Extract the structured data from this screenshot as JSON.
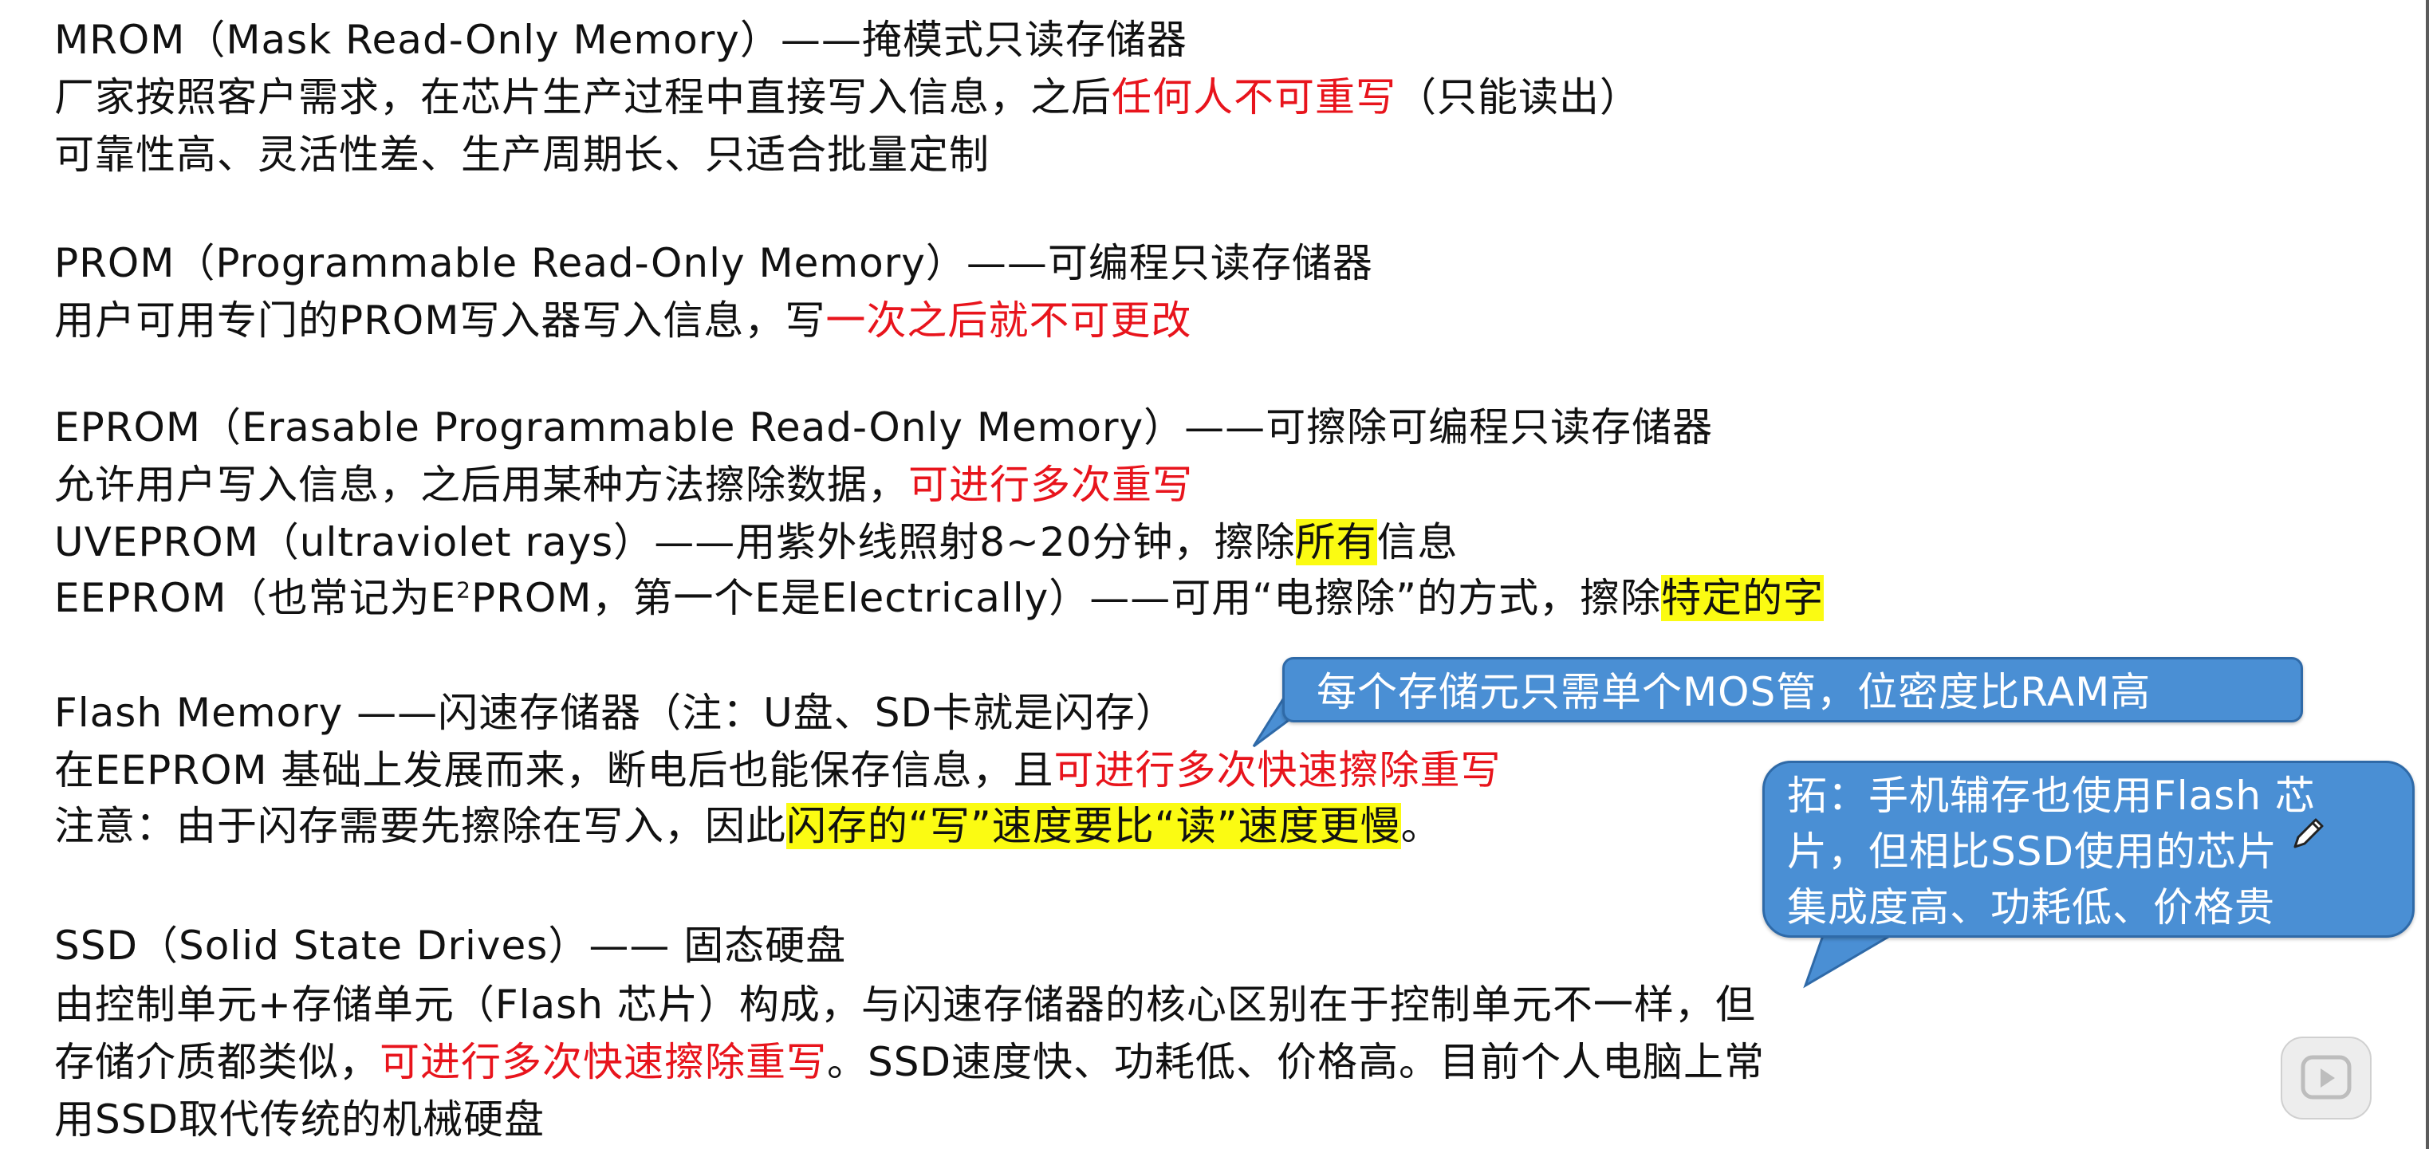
{
  "lines": {
    "l1": [
      "MROM（Mask Read-Only Memory）——掩模式只读存储器"
    ],
    "l2": [
      "厂家按照客户需求，在芯片生产过程中直接写入信息，之后",
      "任何人不可重写",
      "（只能读出）"
    ],
    "l3": [
      "可靠性高、灵活性差、生产周期长、只适合批量定制"
    ],
    "l4": [
      "PROM（Programmable Read-Only Memory）——可编程只读存储器"
    ],
    "l5": [
      "用户可用专门的PROM写入器写入信息，写",
      "一次之后就不可更改"
    ],
    "l6": [
      "EPROM（Erasable Programmable Read-Only Memory）——可擦除可编程只读存储器"
    ],
    "l7": [
      "允许用户写入信息，之后用某种方法擦除数据，",
      "可进行多次重写"
    ],
    "l8": [
      "UVEPROM（ultraviolet rays）——用紫外线照射8~20分钟，擦除",
      "所有",
      "信息"
    ],
    "l9": [
      "EEPROM（也常记为E",
      "2",
      "PROM，第一个E是Electrically）——可用“电擦除”的方式，擦除",
      "特定的字"
    ],
    "l10": [
      "Flash Memory ——闪速存储器（注：U盘、SD卡就是闪存）"
    ],
    "l11": [
      "在EEPROM 基础上发展而来，断电后也能保存信息，且",
      "可进行多次快速擦除重写"
    ],
    "l12": [
      "注意：由于闪存需要先擦除在写入，因此",
      "闪存的“写”速度要比“读”速度更慢",
      "。"
    ],
    "l13": [
      "SSD（Solid State Drives）—— 固态硬盘"
    ],
    "l14": [
      "由控制单元+存储单元（Flash 芯片）构成，与闪速存储器的核心区别在于控制单元不一样，但"
    ],
    "l15": [
      "存储介质都类似，",
      "可进行多次快速擦除重写",
      "。SSD速度快、功耗低、价格高。目前个人电脑上常"
    ],
    "l16": [
      "用SSD取代传统的机械硬盘"
    ]
  },
  "callouts": {
    "mos": "每个存储元只需单个MOS管，位密度比RAM高",
    "phone": [
      "拓：手机辅存也使用Flash 芯",
      "片，但相比SSD使用的芯片",
      "集成度高、功耗低、价格贵"
    ]
  },
  "colors": {
    "red": "#e8141c",
    "highlight": "#fbfb12",
    "callout_fill": "#4a8fd4"
  },
  "icons": {
    "play": "play-icon",
    "pen": "pen-cursor-icon"
  }
}
